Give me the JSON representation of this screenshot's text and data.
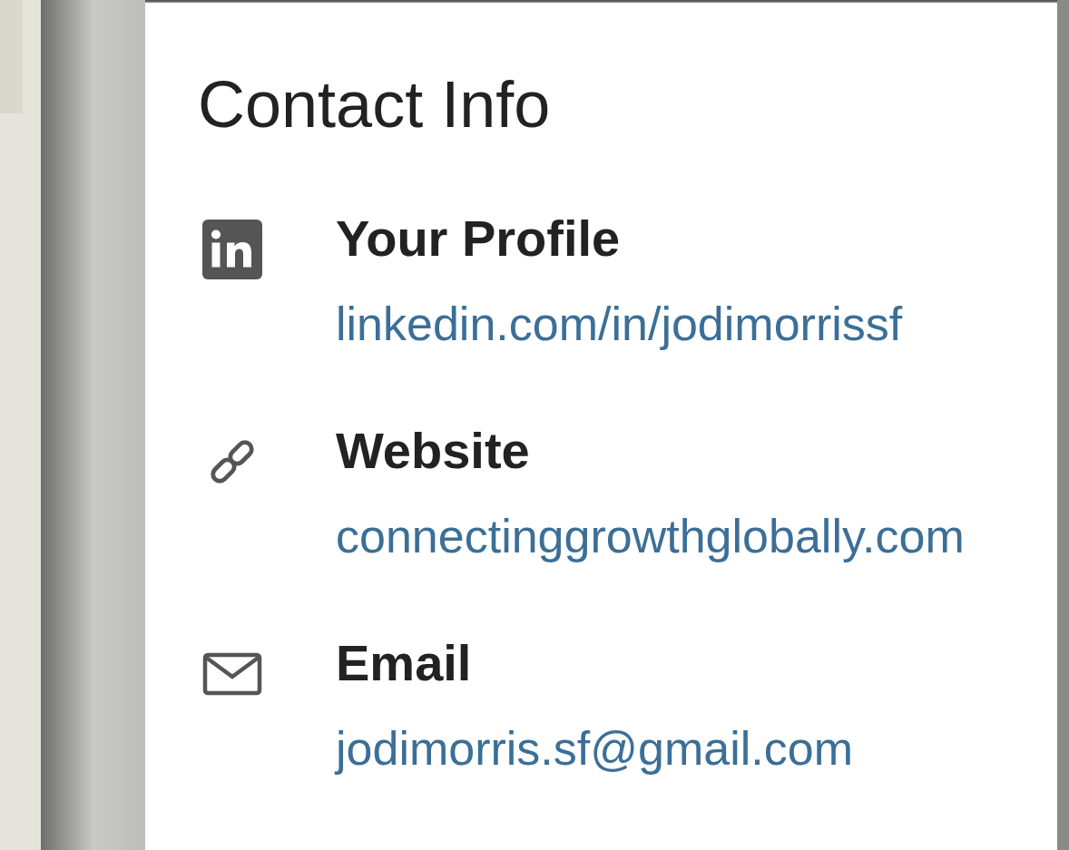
{
  "heading": "Contact Info",
  "items": [
    {
      "kind": "profile",
      "label": "Your Profile",
      "value": "linkedin.com/in/jodimorrissf"
    },
    {
      "kind": "website",
      "label": "Website",
      "value": "connectinggrowthglobally.com"
    },
    {
      "kind": "email",
      "label": "Email",
      "value": "jodimorris.sf@gmail.com"
    }
  ]
}
